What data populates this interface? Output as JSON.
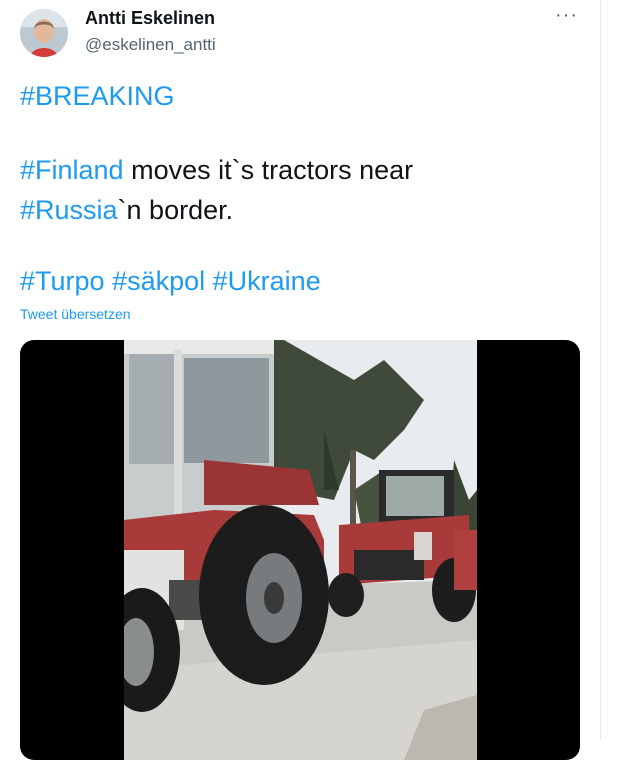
{
  "tweet": {
    "author_name": "Antti Eskelinen",
    "author_handle": "@eskelinen_antti",
    "more_symbol": "···",
    "line1": {
      "tag": "#BREAKING"
    },
    "line2": {
      "tag": "#Finland",
      "text": " moves it`s tractors near"
    },
    "line3": {
      "tag": "#Russia",
      "text": "`n border."
    },
    "line4": {
      "tags": [
        "#Turpo",
        "#säkpol",
        "#Ukraine"
      ]
    },
    "translate_label": "Tweet übersetzen"
  },
  "colors": {
    "link": "#1d9bf0",
    "text": "#0f1419",
    "muted": "#536471",
    "tractor_red": "#a83a3a"
  },
  "icons": {
    "more": "more-options-icon"
  }
}
